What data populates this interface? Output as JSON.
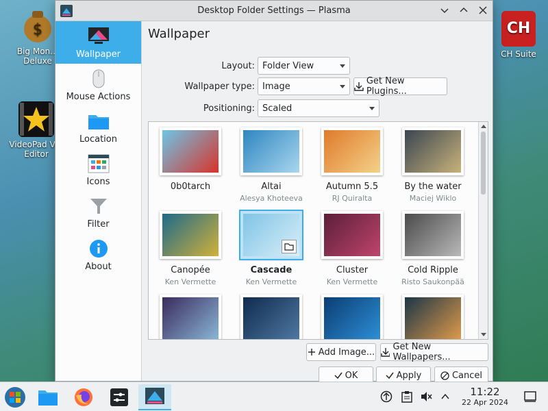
{
  "desktop": {
    "icons": [
      {
        "label": "Big Mon… Deluxe",
        "icon": "money-bag-icon"
      },
      {
        "label": "VideoPad V… Editor",
        "icon": "videopad-star-icon"
      },
      {
        "label": "CH Suite",
        "icon": "nch-suite-icon"
      }
    ]
  },
  "window": {
    "title": "Desktop Folder Settings — Plasma",
    "controls": [
      "minimize",
      "maximize",
      "close"
    ]
  },
  "sidebar": {
    "items": [
      {
        "label": "Wallpaper",
        "icon": "monitor-icon"
      },
      {
        "label": "Mouse Actions",
        "icon": "mouse-icon"
      },
      {
        "label": "Location",
        "icon": "folder-icon"
      },
      {
        "label": "Icons",
        "icon": "icons-grid-icon"
      },
      {
        "label": "Filter",
        "icon": "funnel-icon"
      },
      {
        "label": "About",
        "icon": "info-icon"
      }
    ]
  },
  "main": {
    "page_title": "Wallpaper",
    "layout_label": "Layout:",
    "layout_value": "Folder View",
    "wallpaper_type_label": "Wallpaper type:",
    "wallpaper_type_value": "Image",
    "get_plugins_label": "Get New Plugins...",
    "positioning_label": "Positioning:",
    "positioning_value": "Scaled",
    "wallpapers": [
      {
        "name": "0b0tarch",
        "author": "",
        "colors": [
          "#6cc6e8",
          "#d8332a"
        ]
      },
      {
        "name": "Altai",
        "author": "Alesya Khoteeva",
        "colors": [
          "#2e86c1",
          "#a9d6ee"
        ]
      },
      {
        "name": "Autumn 5.5",
        "author": "RJ Quiralta",
        "colors": [
          "#e07a2a",
          "#f3d28a"
        ]
      },
      {
        "name": "By the water",
        "author": "Maciej Wiklo",
        "colors": [
          "#3b4652",
          "#c8b27a"
        ]
      },
      {
        "name": "Canopée",
        "author": "Ken Vermette",
        "colors": [
          "#1d6a8a",
          "#d2b13a"
        ]
      },
      {
        "name": "Cascade",
        "author": "Ken Vermette",
        "colors": [
          "#7fc4e6",
          "#d9eef8"
        ]
      },
      {
        "name": "Cluster",
        "author": "Ken Vermette",
        "colors": [
          "#5b1f3a",
          "#c0446b"
        ]
      },
      {
        "name": "Cold Ripple",
        "author": "Risto Saukonpää",
        "colors": [
          "#4b4b4b",
          "#b9b9b9"
        ]
      },
      {
        "name": "",
        "author": "",
        "colors": [
          "#3a2b5e",
          "#8ab6d6"
        ]
      },
      {
        "name": "",
        "author": "",
        "colors": [
          "#0f2b4d",
          "#4f78a3"
        ]
      },
      {
        "name": "",
        "author": "",
        "colors": [
          "#0b3d73",
          "#2d8fd6"
        ]
      },
      {
        "name": "",
        "author": "",
        "colors": [
          "#1b3547",
          "#e09a4a"
        ]
      }
    ],
    "add_image_label": "Add Image...",
    "get_wallpapers_label": "Get New Wallpapers...",
    "ok_label": "OK",
    "apply_label": "Apply",
    "cancel_label": "Cancel"
  },
  "taskbar": {
    "items": [
      "start-menu-icon",
      "file-manager-icon",
      "firefox-icon",
      "settings-icon",
      "plasma-settings-icon"
    ],
    "tray": [
      "update-icon",
      "clipboard-icon",
      "volume-muted-icon",
      "expand-tray-icon"
    ],
    "time": "11:22",
    "date": "22 Apr 2024",
    "show_desktop": "show-desktop-icon"
  },
  "colors": {
    "accent": "#3daee9",
    "window_bg": "#eff0f1"
  }
}
